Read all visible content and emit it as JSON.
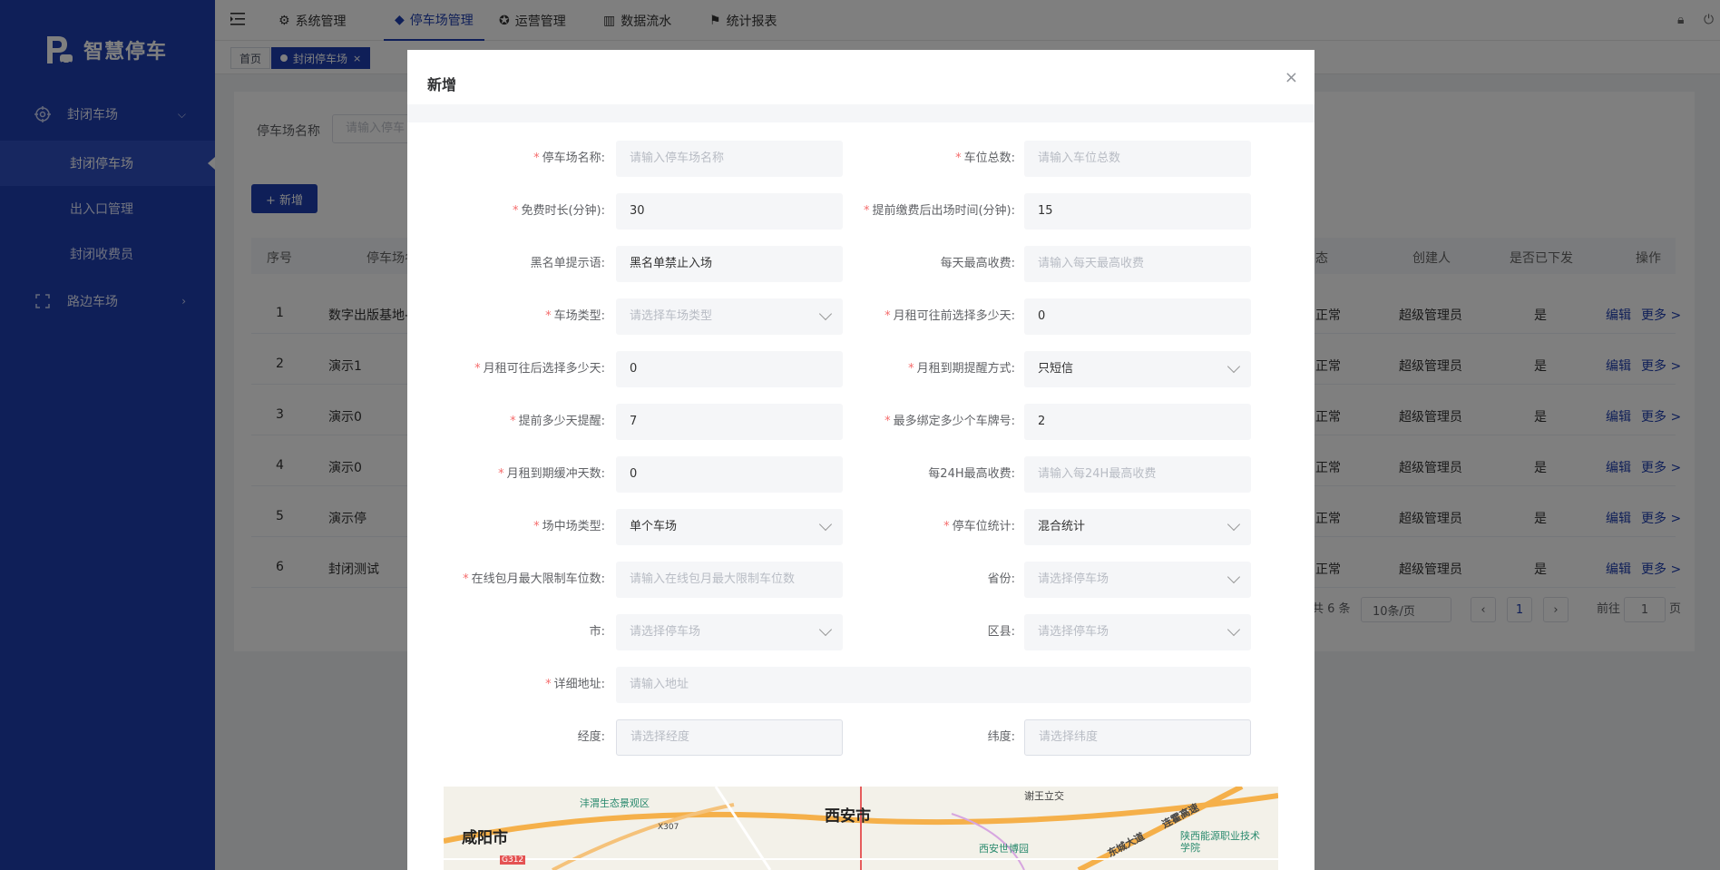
{
  "app": {
    "name": "智慧停车"
  },
  "sidebar": {
    "groups": [
      {
        "label": "封闭车场",
        "icon": "target-icon",
        "expanded": true,
        "items": [
          {
            "label": "封闭停车场",
            "active": true
          },
          {
            "label": "出入口管理",
            "active": false
          },
          {
            "label": "封闭收费员",
            "active": false
          }
        ]
      },
      {
        "label": "路边车场",
        "icon": "scan-frame-icon",
        "expanded": false
      }
    ]
  },
  "topnav": {
    "tabs": [
      {
        "label": "系统管理",
        "icon": "gear-icon"
      },
      {
        "label": "停车场管理",
        "icon": "cube-icon",
        "active": true
      },
      {
        "label": "运营管理",
        "icon": "settings-circle-icon"
      },
      {
        "label": "数据流水",
        "icon": "bar-chart-icon"
      },
      {
        "label": "统计报表",
        "icon": "flag-icon"
      }
    ]
  },
  "tags": [
    {
      "label": "首页"
    },
    {
      "label": "封闭停车场",
      "active": true,
      "close": "×"
    }
  ],
  "page": {
    "filter_label": "停车场名称",
    "filter_placeholder": "请输入停车",
    "add_button": "+ 新增",
    "table": {
      "headers": {
        "index": "序号",
        "name": "停车场名",
        "status": "态",
        "creator": "创建人",
        "issued": "是否已下发",
        "actions": "操作"
      },
      "rows": [
        {
          "index": "1",
          "name": "数字出版基地-",
          "status": "正常",
          "creator": "超级管理员",
          "issued": "是"
        },
        {
          "index": "2",
          "name": "演示1",
          "status": "正常",
          "creator": "超级管理员",
          "issued": "是"
        },
        {
          "index": "3",
          "name": "演示0",
          "status": "正常",
          "creator": "超级管理员",
          "issued": "是"
        },
        {
          "index": "4",
          "name": "演示0",
          "status": "正常",
          "creator": "超级管理员",
          "issued": "是"
        },
        {
          "index": "5",
          "name": "演示停",
          "status": "正常",
          "creator": "超级管理员",
          "issued": "是"
        },
        {
          "index": "6",
          "name": "封闭测试",
          "status": "正常",
          "creator": "超级管理员",
          "issued": "是"
        }
      ],
      "edit_label": "编辑",
      "more_label": "更多 >"
    },
    "pagination": {
      "total": "共 6 条",
      "page_size": "10条/页",
      "current": "1",
      "goto_label": "前往",
      "goto_value": "1",
      "page_suffix": "页"
    }
  },
  "dialog": {
    "title": "新增",
    "close": "×",
    "fields": {
      "name": {
        "label": "停车场名称:",
        "placeholder": "请输入停车场名称",
        "required": true
      },
      "total_spaces": {
        "label": "车位总数:",
        "placeholder": "请输入车位总数",
        "required": true
      },
      "free_minutes": {
        "label": "免费时长(分钟):",
        "value": "30",
        "required": true
      },
      "exit_minutes": {
        "label": "提前缴费后出场时间(分钟):",
        "value": "15",
        "required": true
      },
      "blacklist_tip": {
        "label": "黑名单提示语:",
        "value": "黑名单禁止入场"
      },
      "daily_max_fee": {
        "label": "每天最高收费:",
        "placeholder": "请输入每天最高收费"
      },
      "lot_type": {
        "label": "车场类型:",
        "placeholder": "请选择车场类型",
        "required": true
      },
      "monthly_before_days": {
        "label": "月租可往前选择多少天:",
        "value": "0",
        "required": true
      },
      "monthly_after_days": {
        "label": "月租可往后选择多少天:",
        "value": "0",
        "required": true
      },
      "monthly_remind_mode": {
        "label": "月租到期提醒方式:",
        "value": "只短信",
        "required": true
      },
      "remind_days_ahead": {
        "label": "提前多少天提醒:",
        "value": "7",
        "required": true
      },
      "max_plates": {
        "label": "最多绑定多少个车牌号:",
        "value": "2",
        "required": true
      },
      "grace_days": {
        "label": "月租到期缓冲天数:",
        "value": "0",
        "required": true
      },
      "max_fee_24h": {
        "label": "每24H最高收费:",
        "placeholder": "请输入每24H最高收费"
      },
      "venue_type": {
        "label": "场中场类型:",
        "value": "单个车场",
        "required": true
      },
      "space_stat": {
        "label": "停车位统计:",
        "value": "混合统计",
        "required": true
      },
      "online_monthly_limit": {
        "label": "在线包月最大限制车位数:",
        "placeholder": "请输入在线包月最大限制车位数",
        "required": true
      },
      "province": {
        "label": "省份:",
        "placeholder": "请选择停车场"
      },
      "city": {
        "label": "市:",
        "placeholder": "请选择停车场"
      },
      "district": {
        "label": "区县:",
        "placeholder": "请选择停车场"
      },
      "address": {
        "label": "详细地址:",
        "placeholder": "请输入地址",
        "required": true
      },
      "longitude": {
        "label": "经度:",
        "placeholder": "请选择经度"
      },
      "latitude": {
        "label": "纬度:",
        "placeholder": "请选择纬度"
      }
    },
    "map": {
      "labels": [
        "西安市",
        "咸阳市",
        "沣渭生态景观区",
        "谢王立交",
        "西安世博园",
        "陕西能源职业技术学院",
        "东城大道",
        "连霍高速",
        "X307",
        "G312"
      ]
    }
  }
}
